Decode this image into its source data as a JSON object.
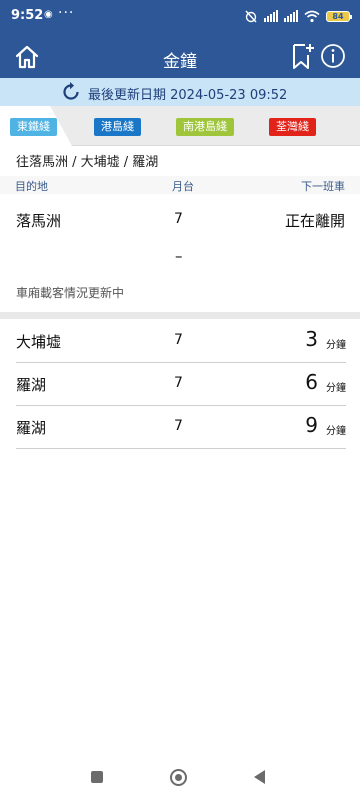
{
  "status_bar": {
    "time": "9:52",
    "dots": "···",
    "battery": "84"
  },
  "header": {
    "title": "金鐘"
  },
  "update": {
    "text": "最後更新日期 2024-05-23 09:52"
  },
  "tabs": [
    {
      "label": "東鐵綫",
      "color": "#4fb3e3",
      "active": true
    },
    {
      "label": "港島綫",
      "color": "#1a77c8",
      "active": false
    },
    {
      "label": "南港島綫",
      "color": "#9fc63b",
      "active": false
    },
    {
      "label": "荃灣綫",
      "color": "#e2231a",
      "active": false
    }
  ],
  "route": "往落馬洲 / 大埔墟 / 羅湖",
  "columns": {
    "destination": "目的地",
    "platform": "月台",
    "next": "下一班車"
  },
  "first_train": {
    "destination": "落馬洲",
    "platform": "7",
    "status": "正在離開",
    "dash": "–",
    "crowd_note": "車廂載客情況更新中"
  },
  "trains": [
    {
      "destination": "大埔墟",
      "platform": "7",
      "minutes": "3",
      "unit": "分鐘"
    },
    {
      "destination": "羅湖",
      "platform": "7",
      "minutes": "6",
      "unit": "分鐘"
    },
    {
      "destination": "羅湖",
      "platform": "7",
      "minutes": "9",
      "unit": "分鐘"
    }
  ],
  "icons": {
    "home": "home-icon",
    "bookmark": "bookmark-add-icon",
    "info": "info-icon",
    "refresh": "refresh-icon"
  }
}
